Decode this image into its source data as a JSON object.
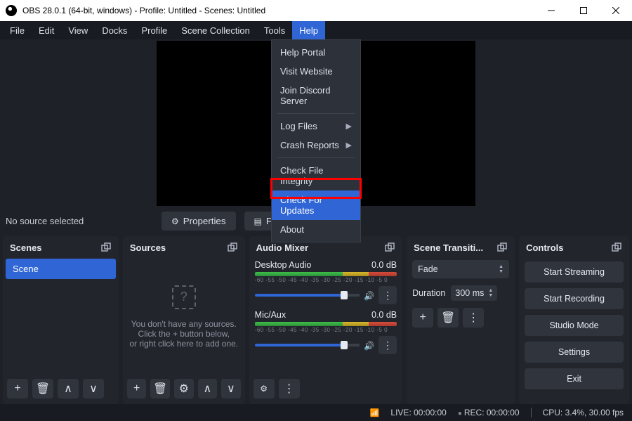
{
  "window": {
    "title": "OBS 28.0.1 (64-bit, windows) - Profile: Untitled - Scenes: Untitled"
  },
  "menubar": [
    "File",
    "Edit",
    "View",
    "Docks",
    "Profile",
    "Scene Collection",
    "Tools",
    "Help"
  ],
  "help_menu": {
    "items": [
      {
        "label": "Help Portal"
      },
      {
        "label": "Visit Website"
      },
      {
        "label": "Join Discord Server"
      },
      {
        "sep": true
      },
      {
        "label": "Log Files",
        "sub": true
      },
      {
        "label": "Crash Reports",
        "sub": true
      },
      {
        "sep": true
      },
      {
        "label": "Check File Integrity"
      },
      {
        "label": "Check For Updates",
        "highlight": true
      },
      {
        "label": "About"
      }
    ]
  },
  "nosource": {
    "label": "No source selected",
    "properties_btn": "Properties",
    "filters_btn": "Filters"
  },
  "panels": {
    "scenes": {
      "title": "Scenes",
      "items": [
        "Scene"
      ]
    },
    "sources": {
      "title": "Sources",
      "empty1": "You don't have any sources.",
      "empty2": "Click the + button below,",
      "empty3": "or right click here to add one."
    },
    "mixer": {
      "title": "Audio Mixer",
      "scale": "-60 -55 -50 -45 -40 -35 -30 -25 -20 -15 -10 -5 0",
      "channels": [
        {
          "name": "Desktop Audio",
          "db": "0.0 dB"
        },
        {
          "name": "Mic/Aux",
          "db": "0.0 dB"
        }
      ]
    },
    "trans": {
      "title": "Scene Transiti...",
      "selected": "Fade",
      "duration_label": "Duration",
      "duration_value": "300 ms"
    },
    "controls": {
      "title": "Controls",
      "buttons": [
        "Start Streaming",
        "Start Recording",
        "Studio Mode",
        "Settings",
        "Exit"
      ]
    }
  },
  "statusbar": {
    "live": "LIVE: 00:00:00",
    "rec": "REC: 00:00:00",
    "cpu": "CPU: 3.4%, 30.00 fps"
  }
}
